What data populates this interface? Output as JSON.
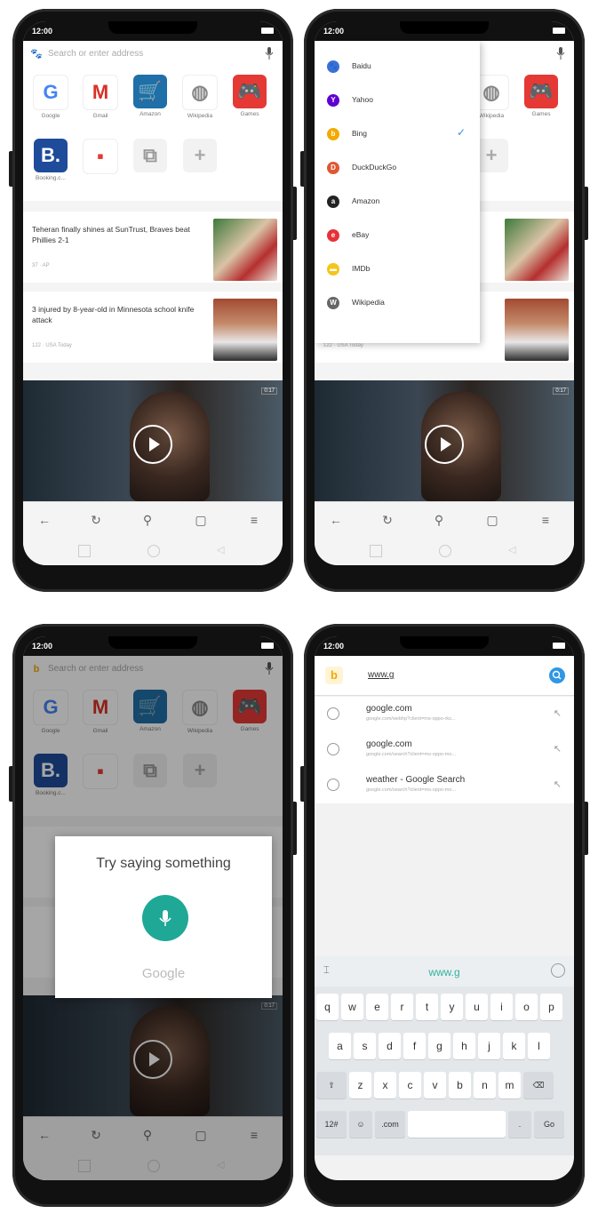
{
  "status": {
    "time": "12:00"
  },
  "browser": {
    "address_placeholder": "Search or enter address",
    "tiles": [
      {
        "label": "Google",
        "glyph": "G",
        "color": "#4285f4",
        "bg": "#ffffff"
      },
      {
        "label": "Gmail",
        "glyph": "M",
        "color": "#d93025",
        "bg": "#ffffff"
      },
      {
        "label": "Amazon",
        "glyph": "🛒",
        "color": "#ffffff",
        "bg": "#1f6fa8"
      },
      {
        "label": "Wikipedia",
        "glyph": "◍",
        "color": "#888888",
        "bg": "#ffffff"
      },
      {
        "label": "Games",
        "glyph": "🎮",
        "color": "#ffffff",
        "bg": "#e53935"
      },
      {
        "label": "Booking.c...",
        "glyph": "B.",
        "color": "#ffffff",
        "bg": "#1e4c9a"
      },
      {
        "label": "",
        "glyph": "▪",
        "color": "#e53935",
        "bg": "#ffffff"
      },
      {
        "label": "",
        "glyph": "⧉",
        "color": "#999999",
        "bg": "#f2f2f2"
      },
      {
        "label": "",
        "glyph": "+",
        "color": "#aaaaaa",
        "bg": "#f2f2f2"
      }
    ],
    "news": [
      {
        "title": "Teheran finally shines at SunTrust, Braves beat Phillies 2-1",
        "meta": "37 · AP"
      },
      {
        "title": "3 injured by 8-year-old in Minnesota school knife attack",
        "meta": "122 · USA Today"
      }
    ],
    "video_duration": "0:17"
  },
  "search_engines": [
    {
      "name": "Baidu",
      "color": "#3b6fd9",
      "glyph": "🐾",
      "selected": false
    },
    {
      "name": "Yahoo",
      "color": "#5f01d1",
      "glyph": "Y",
      "selected": false
    },
    {
      "name": "Bing",
      "color": "#f2a900",
      "glyph": "b",
      "selected": true
    },
    {
      "name": "DuckDuckGo",
      "color": "#de5833",
      "glyph": "D",
      "selected": false
    },
    {
      "name": "Amazon",
      "color": "#222222",
      "glyph": "a",
      "selected": false
    },
    {
      "name": "eBay",
      "color": "#e53238",
      "glyph": "e",
      "selected": false
    },
    {
      "name": "IMDb",
      "color": "#f5c518",
      "glyph": "▬",
      "selected": false
    },
    {
      "name": "Wikipedia",
      "color": "#666666",
      "glyph": "W",
      "selected": false
    }
  ],
  "voice": {
    "prompt": "Try saying something",
    "brand": "Google"
  },
  "search": {
    "query": "www.g",
    "suggestions": [
      {
        "title": "google.com",
        "url": "google.com/webhp?client=ms-oppo-rks..."
      },
      {
        "title": "google.com",
        "url": "google.com/search?client=ms-oppo-mo..."
      },
      {
        "title": "weather - Google Search",
        "url": "google.com/search?client=ms-oppo-mo..."
      }
    ],
    "keyboard_word": "www.g",
    "rows": [
      [
        "q",
        "w",
        "e",
        "r",
        "t",
        "y",
        "u",
        "i",
        "o",
        "p"
      ],
      [
        "a",
        "s",
        "d",
        "f",
        "g",
        "h",
        "j",
        "k",
        "l"
      ],
      [
        "⇧",
        "z",
        "x",
        "c",
        "v",
        "b",
        "n",
        "m",
        "⌫"
      ],
      [
        "12#",
        "☺",
        ".com",
        "",
        ".",
        "Go"
      ]
    ]
  },
  "colors": {
    "accent": "#31b3a0",
    "link": "#3a8ee6"
  }
}
